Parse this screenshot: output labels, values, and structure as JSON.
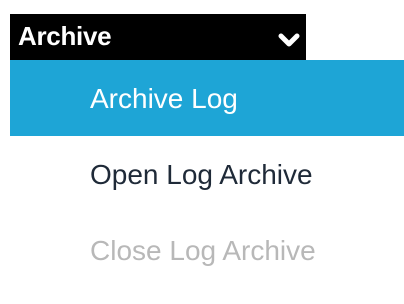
{
  "dropdown": {
    "label": "Archive",
    "icon": "chevron-down-icon",
    "background_color": "#000000",
    "text_color": "#ffffff"
  },
  "menu": {
    "highlight_color": "#1ea5d6",
    "items": [
      {
        "label": "Archive Log",
        "state": "highlighted"
      },
      {
        "label": "Open Log Archive",
        "state": "enabled"
      },
      {
        "label": "Close Log Archive",
        "state": "disabled"
      }
    ]
  }
}
